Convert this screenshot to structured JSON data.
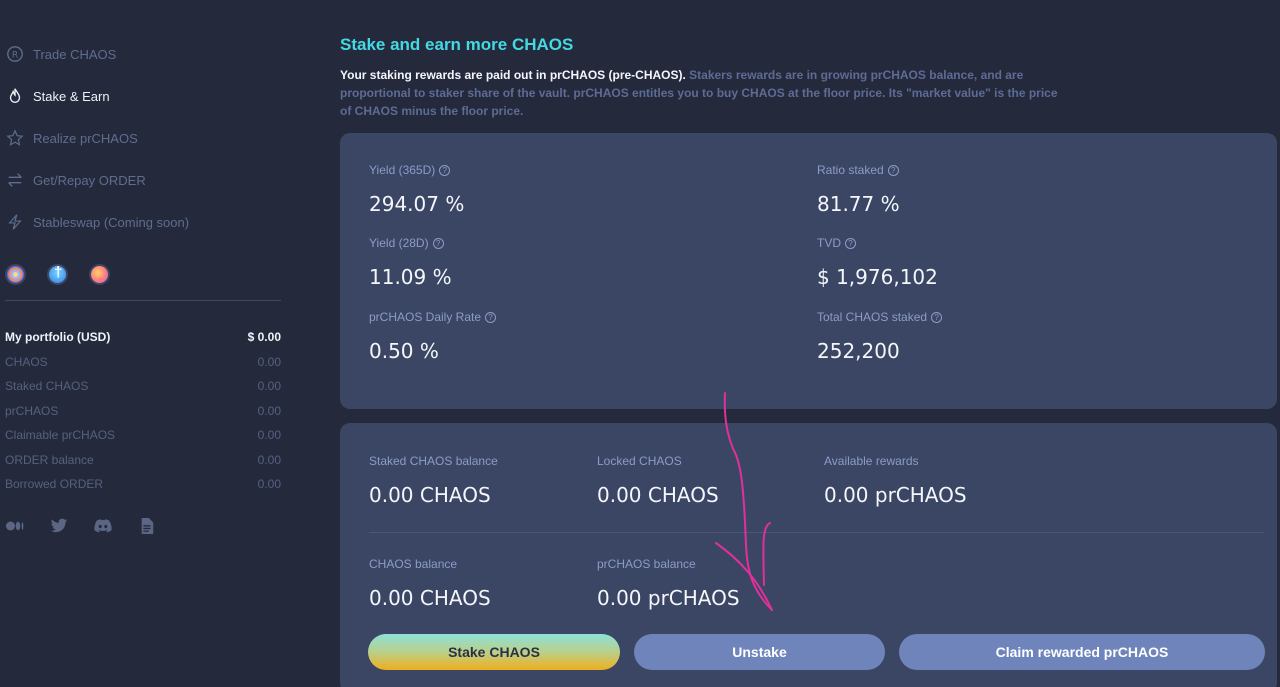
{
  "sidebar": {
    "nav": [
      {
        "label": "Trade CHAOS",
        "icon": "registered-circle-icon",
        "active": false
      },
      {
        "label": "Stake & Earn",
        "icon": "flame-icon",
        "active": true
      },
      {
        "label": "Realize prCHAOS",
        "icon": "star-icon",
        "active": false
      },
      {
        "label": "Get/Repay ORDER",
        "icon": "swap-arrows-icon",
        "active": false
      },
      {
        "label": "Stableswap (Coming soon)",
        "icon": "lightning-icon",
        "active": false
      }
    ],
    "tokens": [
      "chaos-token-icon",
      "order-token-icon",
      "prchaos-token-icon"
    ],
    "portfolio": {
      "title": "My portfolio (USD)",
      "total": "$ 0.00",
      "rows": [
        {
          "label": "CHAOS",
          "value": "0.00"
        },
        {
          "label": "Staked CHAOS",
          "value": "0.00"
        },
        {
          "label": "prCHAOS",
          "value": "0.00"
        },
        {
          "label": "Claimable prCHAOS",
          "value": "0.00"
        },
        {
          "label": "ORDER balance",
          "value": "0.00"
        },
        {
          "label": "Borrowed ORDER",
          "value": "0.00"
        }
      ]
    },
    "socials": [
      "medium-icon",
      "twitter-icon",
      "discord-icon",
      "docs-icon"
    ]
  },
  "main": {
    "title": "Stake and earn more CHAOS",
    "desc_bold": "Your staking rewards are paid out in prCHAOS (pre-CHAOS).",
    "desc_rest": " Stakers rewards are in growing prCHAOS balance, and are proportional to staker share of the vault. prCHAOS entitles you to buy CHAOS at the floor price. Its \"market value\" is the price of CHAOS minus the floor price.",
    "stats": {
      "yield365": {
        "label": "Yield (365D)",
        "value": "294.07 %"
      },
      "ratio": {
        "label": "Ratio staked",
        "value": "81.77 %"
      },
      "yield28": {
        "label": "Yield (28D)",
        "value": "11.09 %"
      },
      "tvd": {
        "label": "TVD",
        "value": "$ 1,976,102"
      },
      "daily": {
        "label": "prCHAOS Daily Rate",
        "value": "0.50 %"
      },
      "total": {
        "label": "Total CHAOS staked",
        "value": "252,200"
      }
    },
    "balances": {
      "staked": {
        "label": "Staked CHAOS balance",
        "value": "0.00 CHAOS"
      },
      "locked": {
        "label": "Locked CHAOS",
        "value": "0.00 CHAOS"
      },
      "rewards": {
        "label": "Available rewards",
        "value": "0.00 prCHAOS"
      },
      "chaos": {
        "label": "CHAOS balance",
        "value": "0.00 CHAOS"
      },
      "prchaos": {
        "label": "prCHAOS balance",
        "value": "0.00 prCHAOS"
      }
    },
    "buttons": {
      "stake": "Stake CHAOS",
      "unstake": "Unstake",
      "claim": "Claim rewarded prCHAOS"
    },
    "q_mark": "?",
    "colors": {
      "accent": "#44d8e3",
      "annotation": "#e0309a"
    }
  }
}
